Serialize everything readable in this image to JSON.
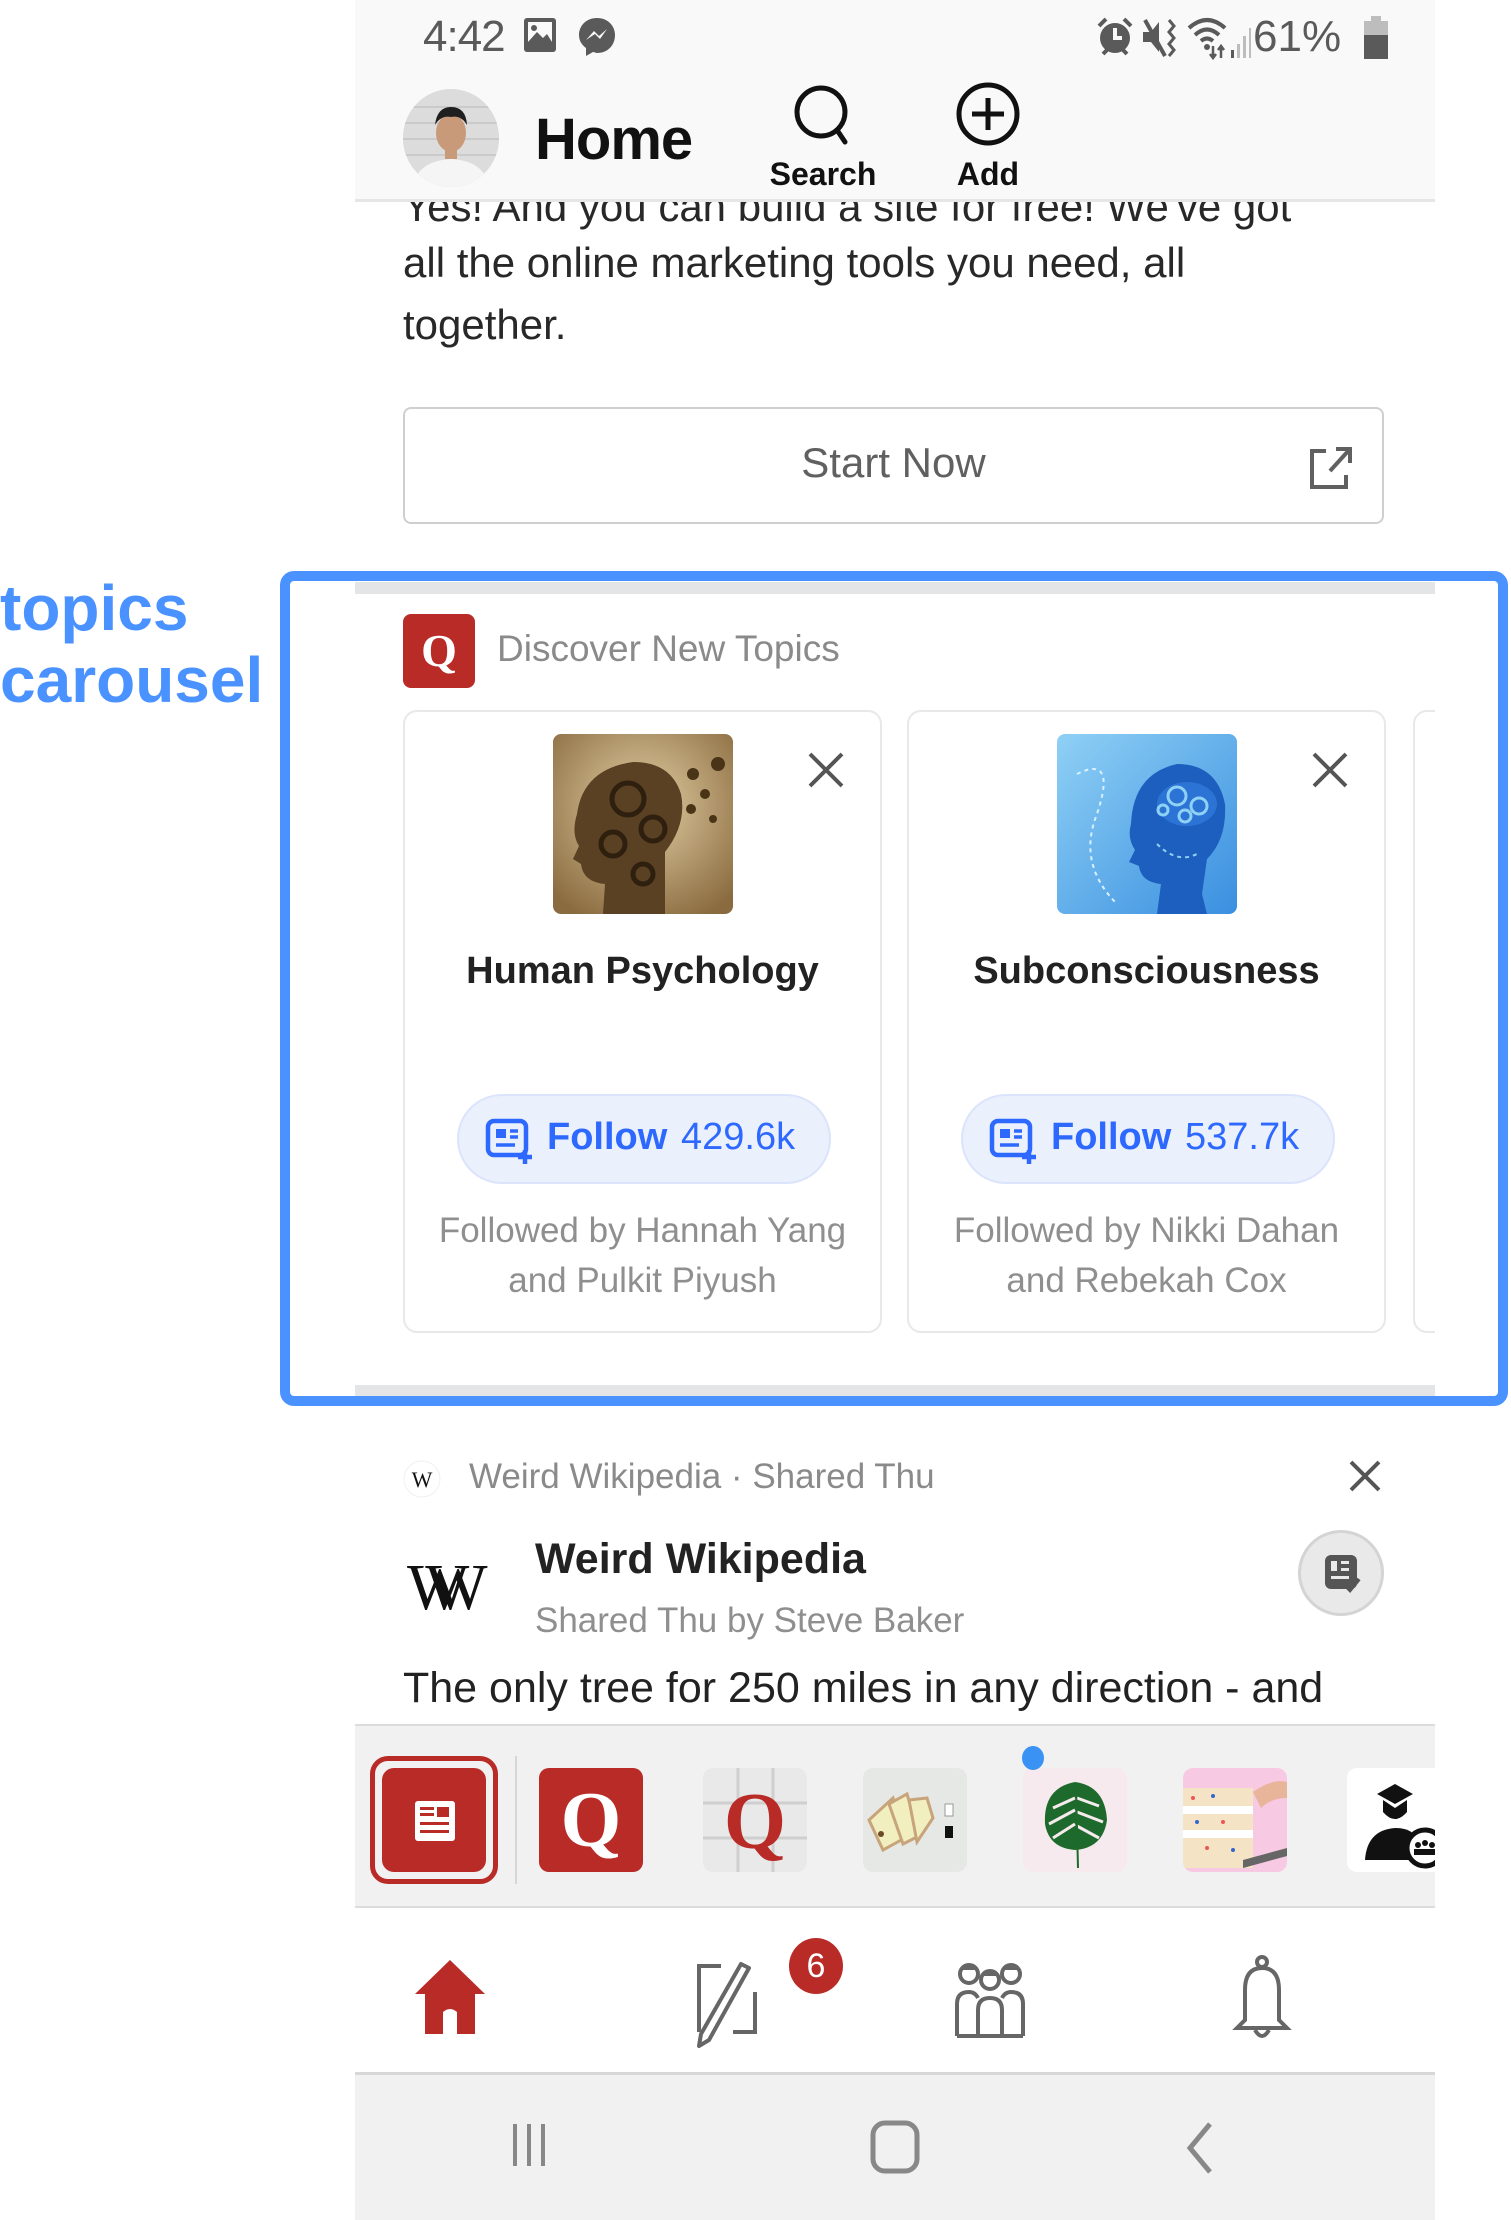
{
  "annotation": {
    "label_line1": "topics",
    "label_line2": "carousel",
    "color": "#4a92ff"
  },
  "status_bar": {
    "time": "4:42",
    "left_icons": [
      "gallery-icon",
      "messenger-icon"
    ],
    "right_icons": [
      "alarm-icon",
      "vibrate-icon",
      "wifi-icon",
      "signal-icon"
    ],
    "battery_percent": "61%"
  },
  "header": {
    "title": "Home",
    "search_label": "Search",
    "add_label": "Add"
  },
  "ad": {
    "line1": "Yes! And you can build a site for free! We've got",
    "line2": "all the online marketing tools you need, all",
    "line3": "together.",
    "cta_label": "Start Now"
  },
  "discover": {
    "title": "Discover New Topics",
    "badge_letter": "Q",
    "cards": [
      {
        "name": "Human Psychology",
        "follow_label": "Follow",
        "follower_count": "429.6k",
        "followed_by_line1": "Followed by Hannah Yang",
        "followed_by_line2": "and Pulkit Piyush"
      },
      {
        "name": "Subconsciousness",
        "follow_label": "Follow",
        "follower_count": "537.7k",
        "followed_by_line1": "Followed by Nikki Dahan",
        "followed_by_line2": "and Rebekah Cox"
      }
    ]
  },
  "post": {
    "meta": "Weird Wikipedia · Shared Thu",
    "logo_small": "W",
    "logo_large": "W",
    "space_name": "Weird Wikipedia",
    "subtitle": "Shared Thu by Steve Baker",
    "body": "The only tree for 250 miles in any direction - and"
  },
  "spaces_strip": {
    "items": [
      {
        "name": "following-feed",
        "selected": true
      },
      {
        "name": "quora-space",
        "letter": "Q"
      },
      {
        "name": "quora-tiles-space",
        "letter": "Q"
      },
      {
        "name": "tags-space"
      },
      {
        "name": "plant-space",
        "unread": true
      },
      {
        "name": "cake-space"
      },
      {
        "name": "education-space"
      }
    ]
  },
  "bottom_nav": {
    "items": [
      "home",
      "answer",
      "spaces",
      "notifications"
    ],
    "answer_badge": "6"
  },
  "colors": {
    "brand_red": "#b92b27",
    "follow_blue": "#2e69ff"
  }
}
